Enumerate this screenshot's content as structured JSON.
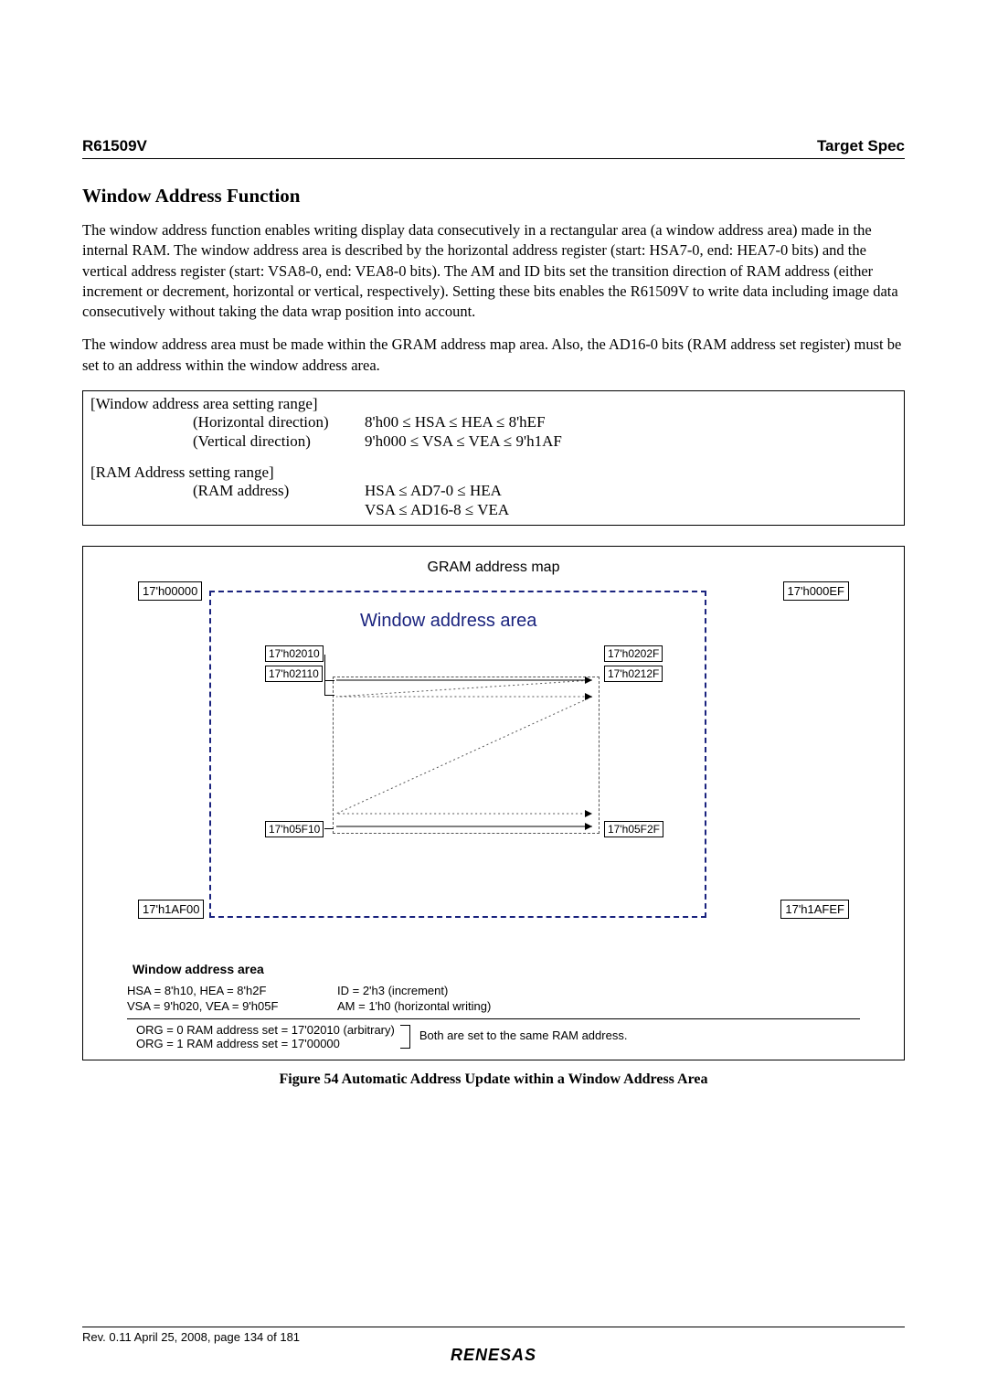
{
  "header": {
    "left": "R61509V",
    "right": "Target Spec"
  },
  "title": "Window Address Function",
  "para1": "The window address function enables writing display data consecutively in a rectangular area (a window address area) made in the internal RAM. The window address area is described by the horizontal address register (start: HSA7-0, end: HEA7-0 bits) and the vertical address register (start: VSA8-0, end: VEA8-0 bits). The AM and ID bits set the transition direction of RAM address (either increment or decrement, horizontal or vertical, respectively). Setting these bits enables the R61509V to write data including image data consecutively without taking the data wrap position into account.",
  "para2": "The window address area must be made within the GRAM address map area. Also, the AD16-0 bits (RAM address set register) must be set to an address within the window address area.",
  "ranges": {
    "head1": "[Window address area setting range]",
    "row1_label": "(Horizontal direction)",
    "row1_val": "8'h00 ≤ HSA ≤ HEA ≤ 8'hEF",
    "row2_label": "(Vertical direction)",
    "row2_val": "9'h000 ≤ VSA ≤ VEA ≤ 9'h1AF",
    "head2": "[RAM Address setting range]",
    "row3_label": "(RAM address)",
    "row3_val": "HSA ≤ AD7-0 ≤ HEA",
    "row4_val": "VSA ≤ AD16-8 ≤ VEA"
  },
  "diagram": {
    "title": "GRAM address map",
    "tl": "17'h00000",
    "tr": "17'h000EF",
    "bl": "17'h1AF00",
    "br": "17'h1AFEF",
    "wa_title": "Window address area",
    "i_tl": "17'h02010",
    "i_tr": "17'h0202F",
    "i_ml": "17'h02110",
    "i_mr": "17'h0212F",
    "i_bl": "17'h05F10",
    "i_br": "17'h05F2F"
  },
  "wa": {
    "heading": "Window address area",
    "p1a": "HSA = 8'h10, HEA = 8'h2F",
    "p1b": "ID = 2'h3 (increment)",
    "p2a": "VSA = 9'h020, VEA = 9'h05F",
    "p2b": "AM = 1'h0 (horizontal writing)",
    "org1": "ORG = 0 RAM address set = 17'02010 (arbitrary)",
    "org2": "ORG = 1 RAM address set = 17'00000",
    "note": "Both are set to the same RAM address."
  },
  "caption": "Figure 54   Automatic Address Update within a Window Address Area",
  "footer": {
    "rev": "Rev. 0.11 April 25, 2008, page 134 of 181",
    "logo": "RENESAS"
  }
}
